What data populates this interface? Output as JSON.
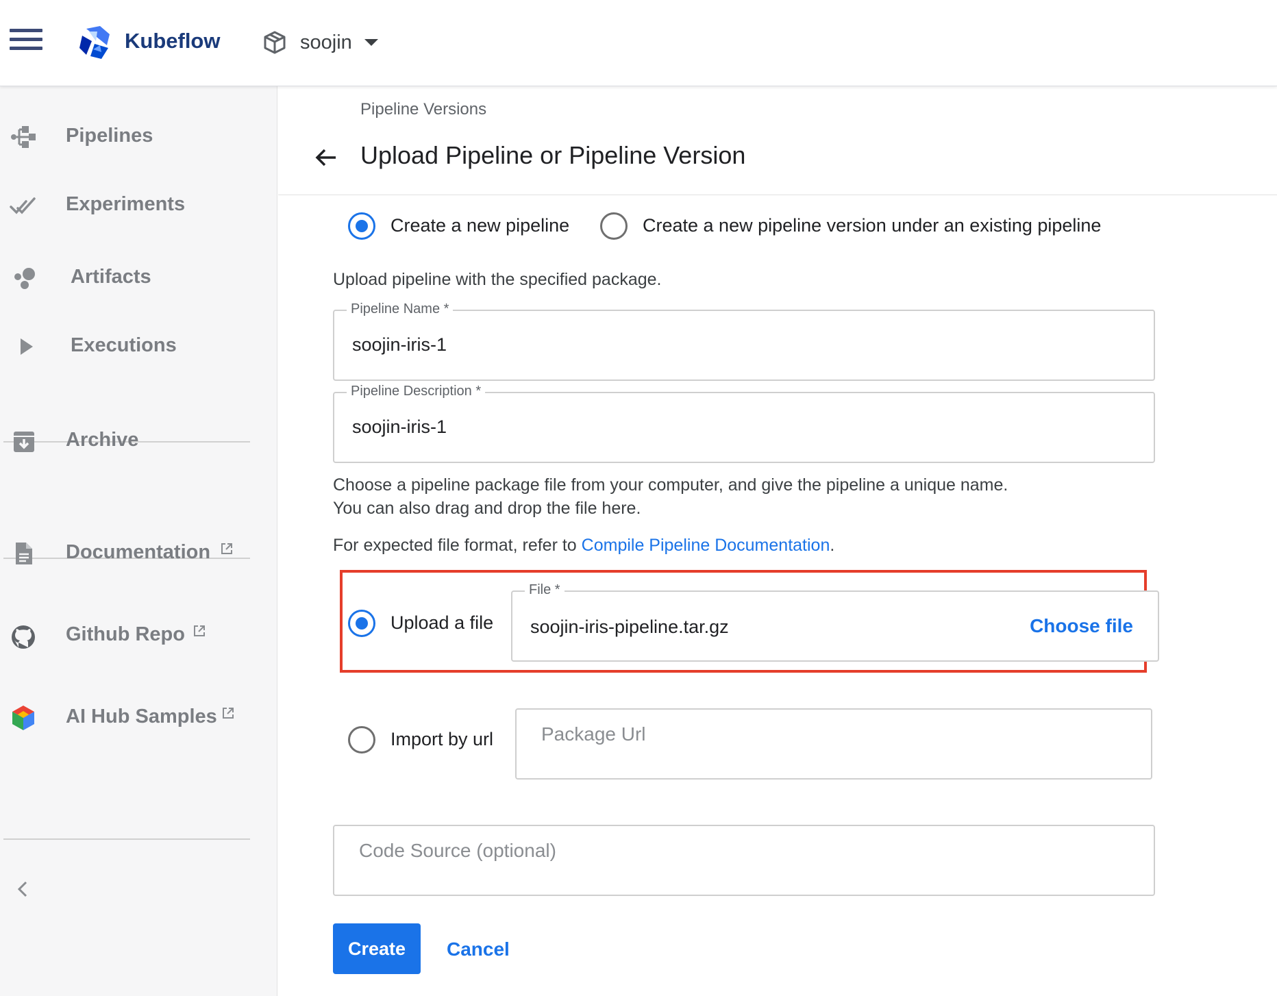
{
  "app": {
    "brand": "Kubeflow",
    "namespace": "soojin"
  },
  "sidebar": {
    "items": [
      {
        "label": "Pipelines",
        "icon": "pipelines-icon"
      },
      {
        "label": "Experiments",
        "icon": "experiments-icon"
      },
      {
        "label": "Artifacts",
        "icon": "artifacts-icon"
      },
      {
        "label": "Executions",
        "icon": "executions-icon"
      },
      {
        "label": "Archive",
        "icon": "archive-icon"
      },
      {
        "label": "Documentation",
        "icon": "document-icon",
        "external": true
      },
      {
        "label": "Github Repo",
        "icon": "github-icon",
        "external": true
      },
      {
        "label": "AI Hub Samples",
        "icon": "ai-hub-icon",
        "external": true
      }
    ]
  },
  "page": {
    "breadcrumb": "Pipeline Versions",
    "title": "Upload Pipeline or Pipeline Version"
  },
  "mode": {
    "option_new": "Create a new pipeline",
    "option_version": "Create a new pipeline version under an existing pipeline",
    "selected": "new"
  },
  "form": {
    "intro": "Upload pipeline with the specified package.",
    "pipeline_name": {
      "label": "Pipeline Name",
      "required": "*",
      "value": "soojin-iris-1"
    },
    "pipeline_description": {
      "label": "Pipeline Description",
      "required": "*",
      "value": "soojin-iris-1"
    },
    "help_line1": "Choose a pipeline package file from your computer, and give the pipeline a unique name.",
    "help_line2": "You can also drag and drop the file here.",
    "format_prefix": "For expected file format, refer to ",
    "format_link": "Compile Pipeline Documentation",
    "format_suffix": ".",
    "source": {
      "upload_label": "Upload a file",
      "url_label": "Import by url",
      "selected": "upload"
    },
    "file": {
      "label": "File",
      "required": "*",
      "value": "soojin-iris-pipeline.tar.gz",
      "choose_label": "Choose file"
    },
    "package_url": {
      "placeholder": "Package Url"
    },
    "code_source": {
      "placeholder": "Code Source (optional)"
    }
  },
  "actions": {
    "create_label": "Create",
    "cancel_label": "Cancel"
  },
  "colors": {
    "accent": "#1a73e8",
    "highlight": "#e53e2b",
    "sidebar_bg": "#f6f6f7",
    "brand_text": "#1a3a7a"
  }
}
